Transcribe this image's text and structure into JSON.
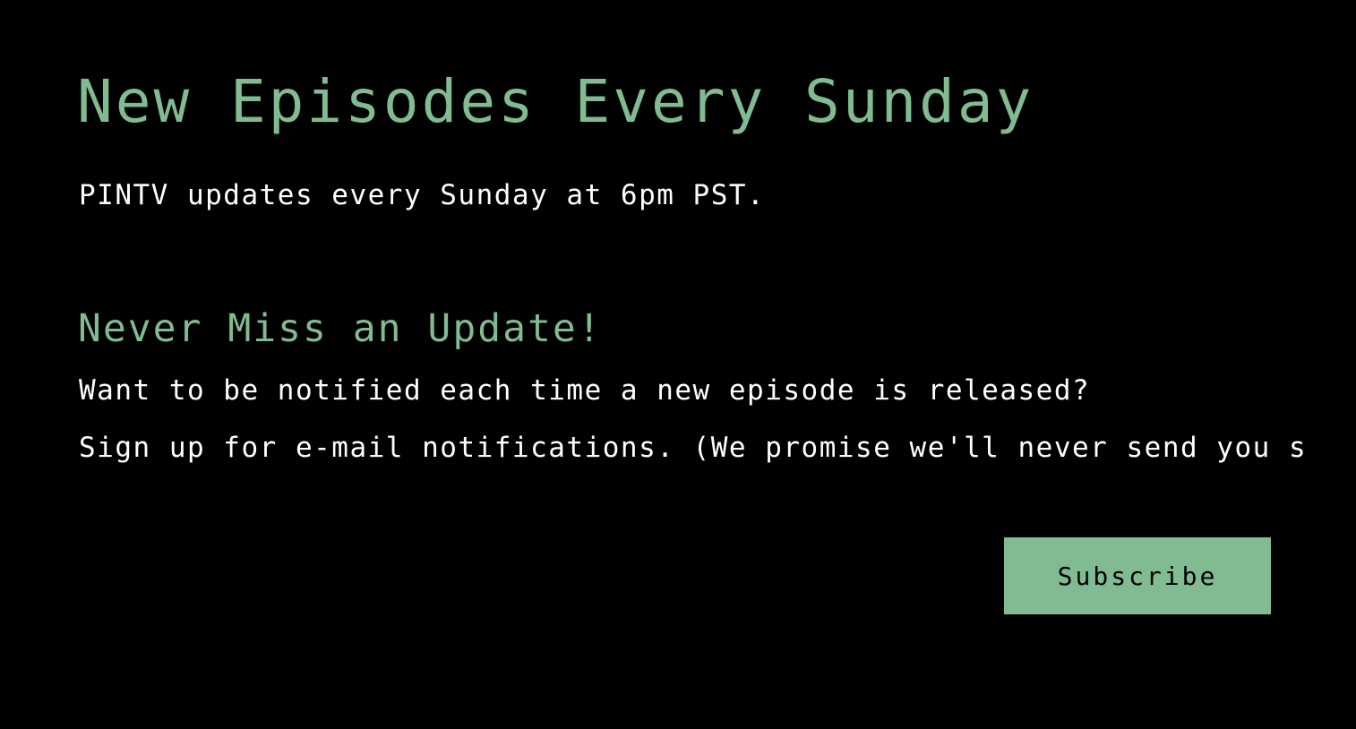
{
  "hero": {
    "title": "New Episodes Every Sunday",
    "schedule_text": "PINTV updates every Sunday at 6pm PST."
  },
  "signup": {
    "heading": "Never Miss an Update!",
    "question": "Want to be notified each time a new episode is released?",
    "description": "Sign up for e-mail notifications. (We promise we'll never send you s",
    "button_label": "Subscribe"
  },
  "colors": {
    "background": "#000000",
    "accent": "#80bb91",
    "text": "#ffffff"
  }
}
